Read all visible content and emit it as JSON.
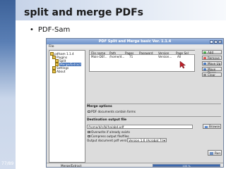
{
  "slide": {
    "title": "split and merge PDFs",
    "bullet": "PDF-Sam",
    "page_number": "77/89"
  },
  "window": {
    "title": "PDF Split and Merge basic Ver. 1.1.4",
    "menu": [
      "File"
    ],
    "tree": {
      "root": "pdfsam 1.1.4",
      "plugins": "Plugins",
      "split": "Split",
      "merge": "Merge/Extract",
      "settings": "Settings",
      "about": "About"
    },
    "table": {
      "headers": [
        "File name",
        "Path",
        "Pages",
        "Password",
        "Version",
        "Page Sel"
      ],
      "row": {
        "file_name": "Main-DEf...",
        "path": "/home/d...",
        "pages": "71",
        "password": "",
        "version": "Version...",
        "page_sel": "All"
      }
    },
    "buttons": {
      "add": "Add",
      "remove": "Remove",
      "move_up": "Move Up",
      "move_down": "Move Down",
      "clear": "Clear"
    },
    "merge_options": {
      "title": "Merge options",
      "pdf_forms": "PDF documents contain forms"
    },
    "destination": {
      "title": "Destination output file",
      "path": "/home/d/c/bl/ha/abd.pdf",
      "browse": "Browse",
      "overwrite": "Overwrite if already exists",
      "compress": "Compress output file/files",
      "version_label": "Output document pdf version:",
      "version_value": "Version 1.6 (Acrobat 7)"
    },
    "run": "Run",
    "status": {
      "label": "Merge/Extract",
      "progress_text": "100 %",
      "progress": 1.0
    },
    "colors": {
      "accent": "#3b6bb5",
      "cursor": "#c0202a"
    }
  }
}
